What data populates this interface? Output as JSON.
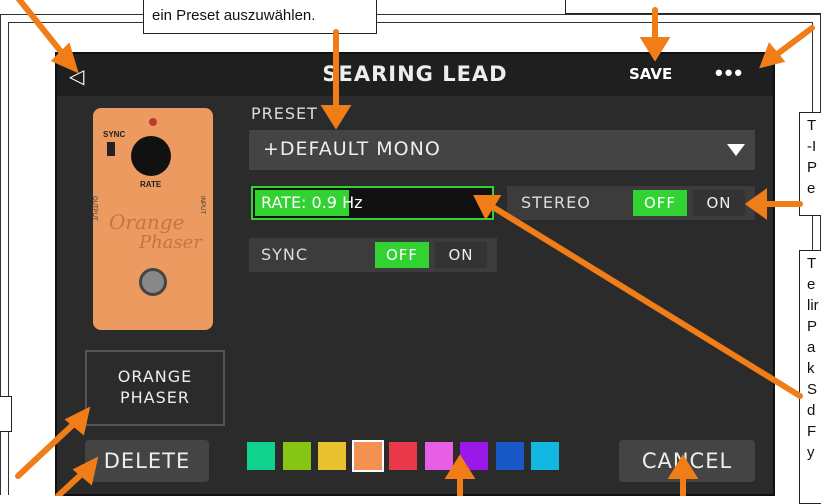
{
  "window": {
    "title": "SEARING LEAD"
  },
  "toolbar": {
    "back_label": "◁",
    "save_label": "SAVE",
    "more_label": "•••"
  },
  "preset": {
    "label": "PRESET",
    "value": "+DEFAULT MONO"
  },
  "params": {
    "rate": {
      "label": "RATE: 0.9 Hz",
      "fill_fraction": 0.4
    },
    "stereo": {
      "label": "STEREO",
      "off": "OFF",
      "on": "ON",
      "selected": "OFF"
    },
    "sync": {
      "label": "SYNC",
      "off": "OFF",
      "on": "ON",
      "selected": "OFF"
    }
  },
  "pedal": {
    "sync_label": "SYNC",
    "rate_label": "RATE",
    "output_label": "OUTPUT",
    "input_label": "INPUT",
    "brand_line1": "Orange",
    "brand_line2": "Phaser",
    "name_line1": "ORANGE",
    "name_line2": "PHASER"
  },
  "actions": {
    "delete_label": "DELETE",
    "cancel_label": "CANCEL"
  },
  "swatches": [
    "#11d28c",
    "#87c514",
    "#e8c22e",
    "#f39250",
    "#e8384a",
    "#e85fe6",
    "#9b19e8",
    "#1859c7",
    "#13b8e0"
  ],
  "callouts": {
    "top_center_partial": "ein Preset auszuwählen.",
    "right_1": [
      "T",
      "-I",
      "P",
      "e"
    ],
    "right_2": [
      "T",
      "e",
      "lir",
      "P",
      "a",
      "k",
      "S",
      "d",
      "F",
      "y"
    ]
  },
  "colors": {
    "accent_green": "#32d232",
    "arrow_orange": "#f07d17",
    "screen_bg": "#2b2b2b"
  }
}
